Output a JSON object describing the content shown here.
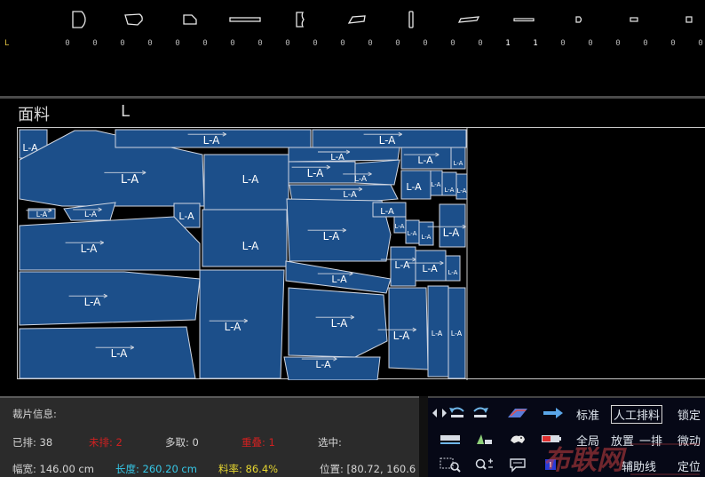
{
  "piece_strip": {
    "size_label": "L",
    "slots": [
      {
        "icon": "tall-rect-piece-icon",
        "count": "0"
      },
      {
        "icon": "sleeve-piece-icon",
        "count": "0"
      },
      {
        "icon": "pocket-piece-icon",
        "count": "0"
      },
      {
        "icon": "long-band-piece-icon",
        "count": "0"
      },
      {
        "icon": "curved-piece-icon",
        "count": "0"
      },
      {
        "icon": "trapezoid-piece-icon",
        "count": "0"
      },
      {
        "icon": "strap-piece-icon",
        "count": "0"
      },
      {
        "icon": "slanted-band-piece-icon",
        "count": "0"
      },
      {
        "icon": "thin-band-piece-icon",
        "count": "0"
      },
      {
        "icon": "small-piece-icon",
        "count": "0"
      },
      {
        "icon": "tiny-rect-piece-icon",
        "count": "0"
      },
      {
        "icon": "tiny-square-piece-icon",
        "count": "0"
      }
    ],
    "counts_row": [
      "0",
      "0",
      "0",
      "0",
      "0",
      "0",
      "0",
      "0",
      "0",
      "0",
      "0",
      "0",
      "0",
      "0",
      "0",
      "0",
      "1",
      "1",
      "0",
      "0",
      "0",
      "0",
      "0",
      "0",
      "0"
    ]
  },
  "fabric": {
    "label": "面料",
    "size": "L"
  },
  "marker": {
    "piece_label": "L-A",
    "piece_color": "#1c4f8a",
    "outline_color": "#cfd6e2",
    "background": "#000000"
  },
  "info_panel": {
    "title": "裁片信息:",
    "placed_label": "已排: 38",
    "unplaced_label": "未排: 2",
    "multi_label": "多取: 0",
    "overlap_label": "重叠: 1",
    "selected_label": "选中:",
    "width_label": "幅宽: 146.00 cm",
    "length_label": "长度: 260.20 cm",
    "rate_label": "料率: 86.4%",
    "position_label": "位置: [80.72, 160.6"
  },
  "tool_panel": {
    "row1": [
      "标准",
      "人工排料",
      "锁定"
    ],
    "row2": [
      "全局",
      "放置",
      "一排",
      "微动"
    ],
    "row3": [
      "辅助线",
      "定位"
    ]
  },
  "watermark": {
    "text": "布联网",
    "brand_color": "#c84040"
  }
}
